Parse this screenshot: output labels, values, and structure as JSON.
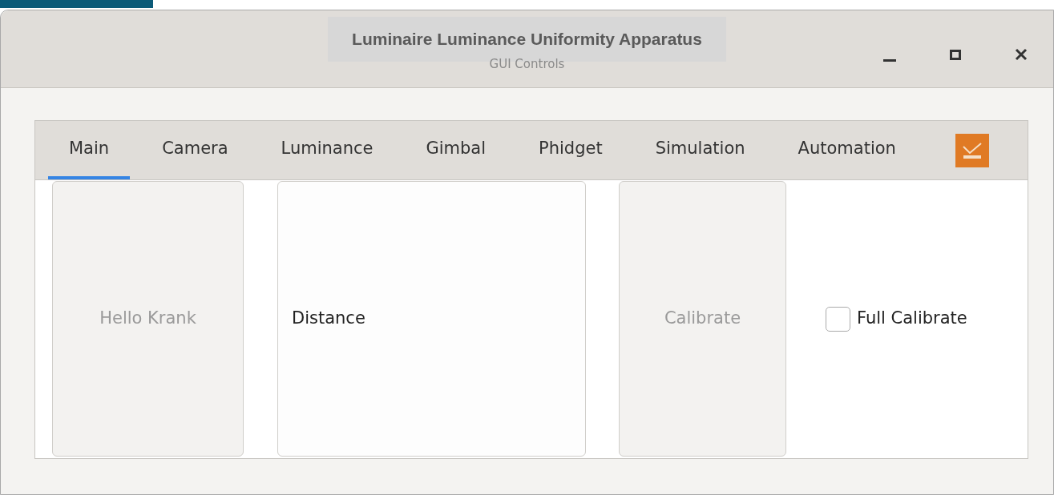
{
  "window": {
    "title": "Luminaire Luminance Uniformity Apparatus",
    "subtitle": "GUI Controls"
  },
  "tabs": [
    {
      "label": "Main",
      "selected": true
    },
    {
      "label": "Camera",
      "selected": false
    },
    {
      "label": "Luminance",
      "selected": false
    },
    {
      "label": "Gimbal",
      "selected": false
    },
    {
      "label": "Phidget",
      "selected": false
    },
    {
      "label": "Simulation",
      "selected": false
    },
    {
      "label": "Automation",
      "selected": false
    }
  ],
  "main": {
    "hello_button": {
      "label": "Hello Krank",
      "disabled": true
    },
    "distance_label": "Distance",
    "calibrate_button": {
      "label": "Calibrate",
      "disabled": true
    },
    "full_calibrate": {
      "label": "Full Calibrate",
      "checked": false
    }
  }
}
